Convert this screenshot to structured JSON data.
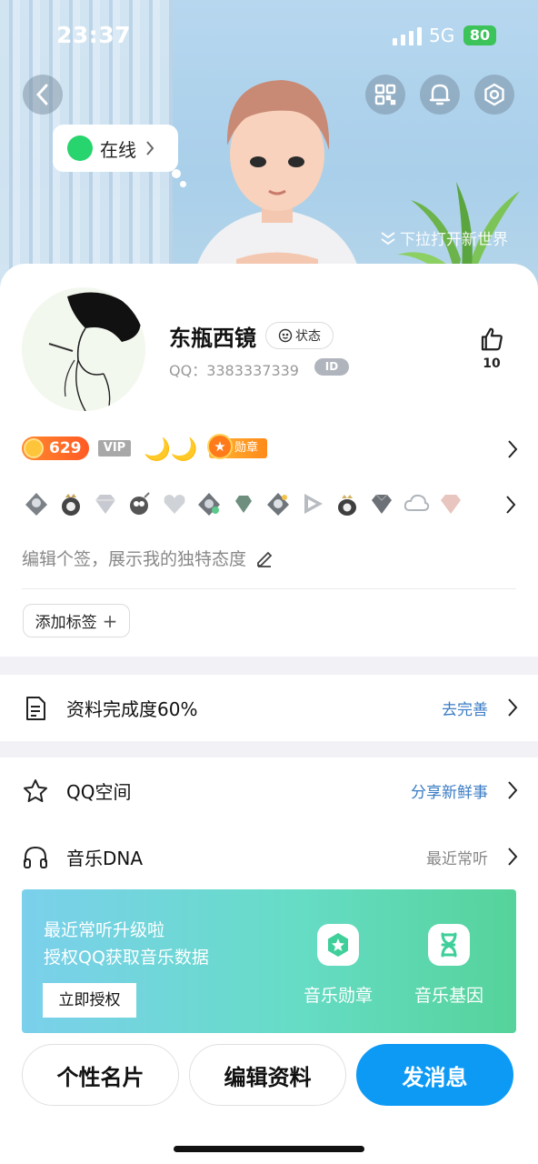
{
  "status_bar": {
    "time": "23:37",
    "network": "5G",
    "battery": "80"
  },
  "header": {
    "online_status": "在线",
    "pull_hint": "下拉打开新世界",
    "icons": [
      "back-icon",
      "qr-code-icon",
      "bell-icon",
      "gear-icon"
    ]
  },
  "profile": {
    "nickname": "东瓶西镜",
    "status_button": "状态",
    "qq_label": "QQ：3383337339",
    "id_badge": "ID",
    "likes": "10",
    "coin_value": "629",
    "vip_label": "VIP",
    "moons": "🌙🌙",
    "medal_label": "勋章",
    "signature_placeholder": "编辑个签，展示我的独特态度",
    "add_tag": "添加标签",
    "add_tag_plus": "+"
  },
  "list": {
    "completion": {
      "label": "资料完成度60%",
      "action": "去完善"
    },
    "qzone": {
      "label": "QQ空间",
      "action": "分享新鲜事"
    },
    "music_dna": {
      "label": "音乐DNA",
      "action": "最近常听"
    }
  },
  "music_card": {
    "line1": "最近常听升级啦",
    "line2": "授权QQ获取音乐数据",
    "authorize": "立即授权",
    "medal": "音乐勋章",
    "gene": "音乐基因"
  },
  "actions": {
    "card": "个性名片",
    "edit": "编辑资料",
    "message": "发消息"
  },
  "colors": {
    "accent_blue": "#0d9af5",
    "online_green": "#28d46d",
    "link_blue": "#3b7cc4"
  }
}
